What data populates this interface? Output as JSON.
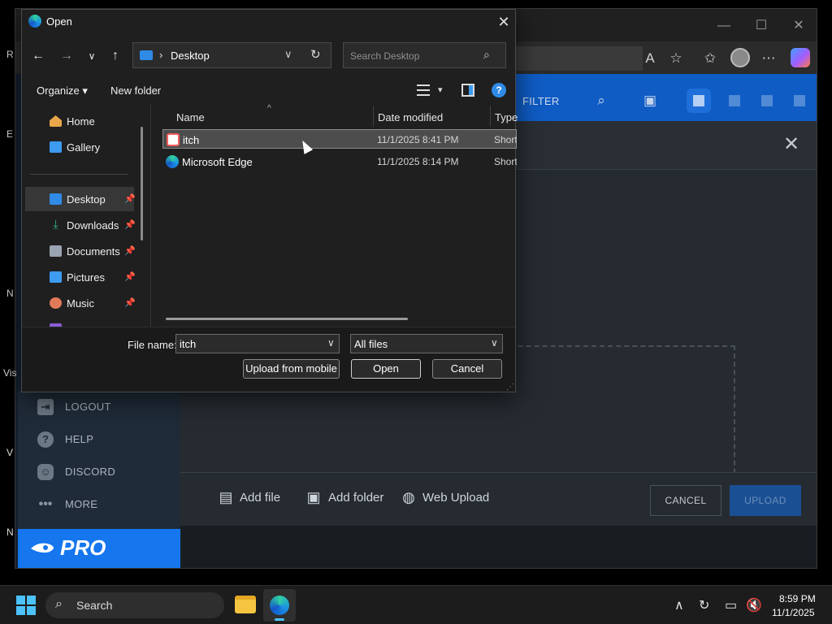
{
  "browser": {
    "window_controls": {
      "minimize": "—",
      "maximize": "☐",
      "close": "✕"
    }
  },
  "app": {
    "topbar": {
      "filter_label": "FILTER"
    },
    "sidebar": {
      "items": [
        {
          "label": "LOGOUT",
          "icon": "logout-icon"
        },
        {
          "label": "HELP",
          "icon": "help-icon"
        },
        {
          "label": "DISCORD",
          "icon": "discord-icon"
        },
        {
          "label": "MORE",
          "icon": "more-icon"
        }
      ],
      "pro_label": "PRO"
    },
    "upload_bar": {
      "add_file": "Add file",
      "add_folder": "Add folder",
      "web_upload": "Web Upload",
      "cancel": "CANCEL",
      "upload": "UPLOAD"
    }
  },
  "desktop_edge": {
    "fragments": [
      "R",
      "E",
      "N",
      "Vis",
      "V",
      "N"
    ]
  },
  "dialog": {
    "title": "Open",
    "path": {
      "location": "Desktop"
    },
    "search": {
      "placeholder": "Search Desktop"
    },
    "commands": {
      "organize": "Organize ▾",
      "new_folder": "New folder"
    },
    "nav": [
      {
        "label": "Home",
        "color": "#e8a64a",
        "pinned": false,
        "selected": false
      },
      {
        "label": "Gallery",
        "color": "#3d9bf0",
        "pinned": false,
        "selected": false
      },
      {
        "label": "Desktop",
        "color": "#2f8be6",
        "pinned": true,
        "selected": true
      },
      {
        "label": "Downloads",
        "color": "#2fb37a",
        "pinned": true,
        "selected": false
      },
      {
        "label": "Documents",
        "color": "#9aa4b1",
        "pinned": true,
        "selected": false
      },
      {
        "label": "Pictures",
        "color": "#3d9bf0",
        "pinned": true,
        "selected": false
      },
      {
        "label": "Music",
        "color": "#e07a5a",
        "pinned": true,
        "selected": false
      }
    ],
    "columns": {
      "name": "Name",
      "date_modified": "Date modified",
      "type": "Type"
    },
    "files": [
      {
        "name": "itch",
        "date": "11/1/2025 8:41 PM",
        "type": "Shortcut",
        "icon_color": "#fa5c5c",
        "selected": true
      },
      {
        "name": "Microsoft Edge",
        "date": "11/1/2025 8:14 PM",
        "type": "Shortcut",
        "icon_color": "#1b8ee6",
        "selected": false
      }
    ],
    "footer": {
      "file_name_label": "File name:",
      "file_name_value": "itch",
      "file_type": "All files",
      "upload_from_mobile": "Upload from mobile",
      "open": "Open",
      "cancel": "Cancel"
    }
  },
  "taskbar": {
    "search_label": "Search",
    "time": "8:59 PM",
    "date": "11/1/2025"
  }
}
